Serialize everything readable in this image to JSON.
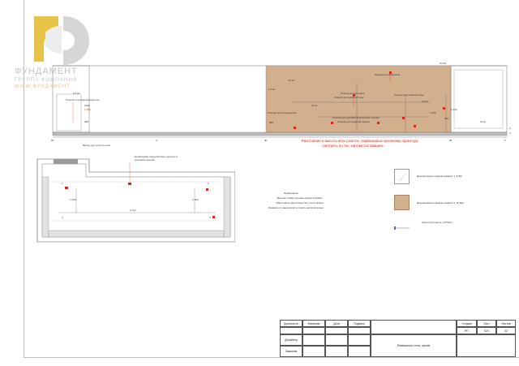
{
  "logo": {
    "line1": "ФУНДАМЕНТ",
    "line2": "ГРУППА КОМПАНИЙ",
    "line3": "WWW.ФУНДАМЕНТ",
    "colors": {
      "gold": "#e8c34a",
      "gray": "#c8c8c8"
    }
  },
  "elevation": {
    "labels": {
      "area_top_right": "0,2 м²",
      "area_left": "3,7 м²",
      "outlet_heater_label": "Розетка под водонагреватель",
      "dim_2100": "2100",
      "dim_1450": "1 450",
      "dim_350": "350",
      "area_wall": "1,5 м²",
      "area_small_1": "2,5 м²",
      "area_center": "21 м²",
      "outlet_hood": "Розетка для вытяжки",
      "outlets_work": "Розетки для рабочей зоны",
      "outlet_oven": "Подсветка шкафчиков",
      "outlet_work_right": "Розетки для рабочей зоны",
      "dim_2200": "2 200",
      "dim_1000": "1 000",
      "dim_450": "450",
      "dim_1400": "1 400",
      "dim_850": "850",
      "outlet_dishwasher": "Розетки для посудомойки",
      "outlet_fridge": "Розетки для духовой встроенной техники",
      "outlet_water": "Розетка для водяной панели",
      "area_right": "10 м²",
      "note_red_1": "Расстояния и высоты всех розеток, привязанных кухонному гарнитуру",
      "note_red_2": "смотреть по тех. картам поставщика",
      "sink_label": "Выход для теплого пола",
      "axis_1": "1",
      "axis_2": "2",
      "axis_3": "3",
      "axis_4": "4",
      "axis_5": "5",
      "side_2": "2",
      "side_3": "3"
    }
  },
  "plan": {
    "callout": "Необходимо предусмотреть розетки в кухонном острове",
    "dim_length": "2 714",
    "dim_left": "1 450",
    "dim_right": "1 450",
    "corner_1": "1",
    "corner_2": "2",
    "corner_3": "3",
    "corner_4": "4"
  },
  "notes": {
    "title": "Примечание:",
    "line1": "-Высота стяжки условно принята 100мм",
    "line2": "-Материалы рассчитаны без учета запаса",
    "line3": "-Размеры со звездочкой уточнить дополнительно"
  },
  "legend": {
    "item1": "Декоративная покраска эффект 1_5,8м²",
    "item2": "Декоративная покраска эффект 2_22,8м²",
    "item3": "Скрытый плинтус_6,672м.п.",
    "color1": "#ffffff",
    "color2": "#d2b08e"
  },
  "title_block": {
    "headers": [
      "Должность",
      "Фамилия",
      "Дата",
      "Подпись"
    ],
    "row1": "Дизайнер",
    "row2": "Заказчик",
    "sheet_title": "Развертка стен, кухня",
    "col_stage": "Стадия",
    "col_sheet": "Лист",
    "col_sheets": "Листов",
    "stage": "РП",
    "sheet": "020",
    "sheets": "32"
  }
}
